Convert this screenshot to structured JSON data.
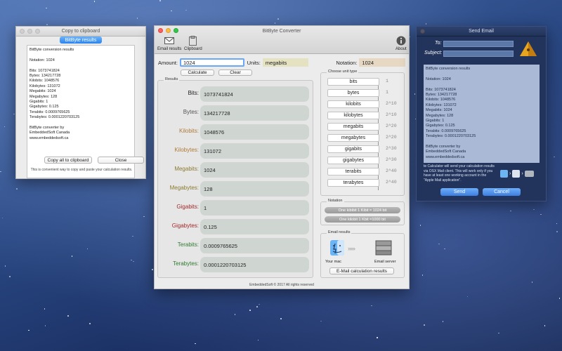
{
  "colors": {
    "bits": "#222222",
    "bytes": "#555555",
    "kilo": "#b07a38",
    "mega": "#8a7a30",
    "giga": "#a02828",
    "tera": "#2f7a2f",
    "accent": "#2a84f0"
  },
  "clipboard": {
    "title": "Copy to clipboard",
    "header_button": "BitByte results",
    "lines": [
      "BitByte conversion results",
      "",
      "Notation: 1024",
      "",
      "Bits: 1073741824",
      "Bytes: 134217728",
      "Kilobits: 1048576",
      "Kilobytes: 131072",
      "Megabits: 1024",
      "Megabytes: 128",
      "Gigabits: 1",
      "Gigabytes: 0.125",
      "Terabits: 0.0009765625",
      "Terabytes: 0.0001220703125",
      "",
      "BitByte converter by",
      "EmbeddedSoft Canada",
      "www.embeddedsoft.ca"
    ],
    "copy_button": "Copy all to clipboard",
    "close_button": "Close",
    "hint": "This is convenient way to copy and paste your calculation results."
  },
  "main": {
    "title": "BitByte Converter",
    "toolbar": {
      "email": "Email results",
      "clipboard": "Clipboard",
      "about": "About"
    },
    "amount_label": "Amount:",
    "amount_value": "1024",
    "units_label": "Units:",
    "units_value": "megabits",
    "notation_label": "Notation:",
    "notation_value": "1024",
    "calculate_button": "Calculate",
    "clear_button": "Clear",
    "results_title": "Results",
    "results": [
      {
        "label": "Bits:",
        "value": "1073741824",
        "color": "bits"
      },
      {
        "label": "Bytes:",
        "value": "134217728",
        "color": "bytes"
      },
      {
        "label": "Kilobits:",
        "value": "1048576",
        "color": "kilo"
      },
      {
        "label": "Kilobytes:",
        "value": "131072",
        "color": "kilo"
      },
      {
        "label": "Megabits:",
        "value": "1024",
        "color": "mega"
      },
      {
        "label": "Megabytes:",
        "value": "128",
        "color": "mega"
      },
      {
        "label": "Gigabits:",
        "value": "1",
        "color": "giga"
      },
      {
        "label": "Gigabytes:",
        "value": "0.125",
        "color": "giga"
      },
      {
        "label": "Terabits:",
        "value": "0.0009765625",
        "color": "tera"
      },
      {
        "label": "Terabytes:",
        "value": "0.0001220703125",
        "color": "tera"
      }
    ],
    "unit_group_title": "Choose unit type",
    "units": [
      "bits",
      "bytes",
      "kilobits",
      "kilobytes",
      "megabits",
      "megabytes",
      "gigabits",
      "gigabytes",
      "terabits",
      "terabytes"
    ],
    "powers": [
      "1",
      "1",
      "2^10",
      "2^10",
      "2^20",
      "2^20",
      "2^30",
      "2^30",
      "2^40",
      "2^40"
    ],
    "notation_title": "Notation",
    "notation_options": [
      "One kibibit 1 Kibit = 1024 bit",
      "One kilobit 1 Kbit =1000 bit"
    ],
    "email_title": "Email results",
    "your_mac": "Your mac",
    "email_server": "Email server",
    "email_button": "E-Mail calculation results",
    "footer": "EmbeddedSoft © 2017 All rights reserved"
  },
  "email": {
    "title": "Send Email",
    "to_label": "To:",
    "subject_label": "Subject:",
    "body_lines": [
      "BitByte conversion results",
      "",
      "Notation: 1024",
      "",
      "Bits: 1073741824",
      "Bytes: 134217728",
      "Kilobits: 1048576",
      "Kilobytes: 131072",
      "Megabits: 1024",
      "Megabytes: 128",
      "Gigabits: 1",
      "Gigabytes: 0.125",
      "Terabits: 0.0009765625",
      "Terabytes: 0.0001220703125",
      "",
      "BitByte converter by",
      "EmbeddedSoft Canada",
      "www.embeddedsoft.ca"
    ],
    "note": "te Calculator will send your calculation results via OSX Mail client. This will work only if you have at least one working account in the \"Apple Mail application\".",
    "send_button": "Send",
    "cancel_button": "Cancel"
  }
}
